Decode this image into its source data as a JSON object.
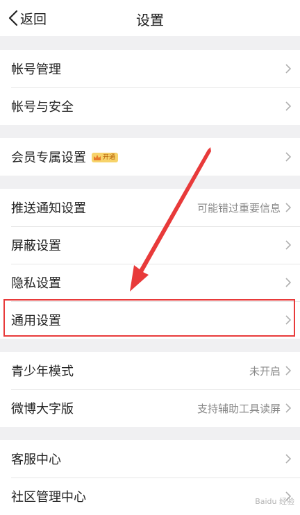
{
  "navbar": {
    "back_label": "返回",
    "title": "设置"
  },
  "groups": [
    {
      "items": [
        {
          "label": "帐号管理"
        },
        {
          "label": "帐号与安全"
        }
      ]
    },
    {
      "items": [
        {
          "label": "会员专属设置",
          "badge": "开通"
        }
      ]
    },
    {
      "items": [
        {
          "label": "推送通知设置",
          "value": "可能错过重要信息"
        },
        {
          "label": "屏蔽设置"
        },
        {
          "label": "隐私设置"
        },
        {
          "label": "通用设置"
        }
      ]
    },
    {
      "items": [
        {
          "label": "青少年模式",
          "value": "未开启"
        },
        {
          "label": "微博大字版",
          "value": "支持辅助工具读屏"
        }
      ]
    },
    {
      "items": [
        {
          "label": "客服中心"
        },
        {
          "label": "社区管理中心"
        }
      ]
    }
  ],
  "annotation": {
    "highlight_color": "#e83a3a"
  },
  "watermark": "Baidu 经验"
}
